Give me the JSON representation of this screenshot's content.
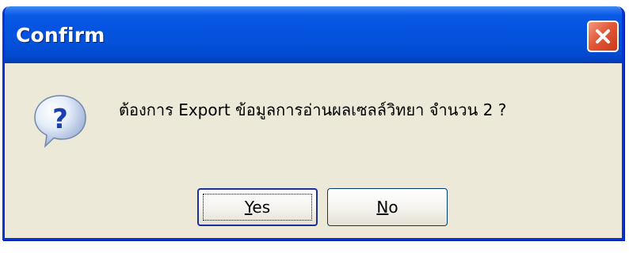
{
  "window": {
    "title": "Confirm"
  },
  "message": {
    "text": "ต้องการ Export ข้อมูลการอ่านผลเซลล์วิทยา จำนวน 2 ?",
    "icon": "question-icon"
  },
  "buttons": {
    "yes_label": "Yes",
    "no_label": "No"
  },
  "colors": {
    "titlebar": "#0553e0",
    "close": "#e2593a",
    "dialog_bg": "#ece9d8"
  }
}
